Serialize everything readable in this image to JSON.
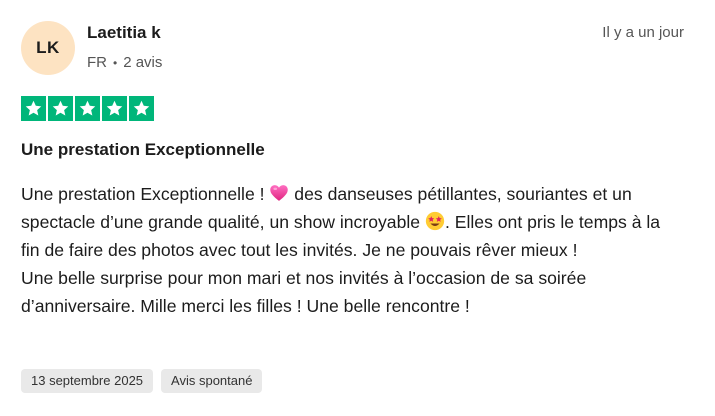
{
  "reviewer": {
    "initials": "LK",
    "name": "Laetitia k",
    "country": "FR",
    "separator": "•",
    "review_count": "2 avis",
    "avatar_color": "#fde3c2"
  },
  "time_ago": "Il y a un jour",
  "rating": {
    "stars": 5,
    "max": 5,
    "color": "#00b67a"
  },
  "review": {
    "title": "Une prestation Exceptionnelle",
    "body_part1": "Une prestation Exceptionnelle ! ",
    "emoji1": "pink-heart",
    "body_part2": " des danseuses pétillantes, souriantes et un spectacle d’une grande qualité, un show incroyable ",
    "emoji2": "star-struck-face",
    "body_part3": ". Elles ont pris le temps à la fin de faire des photos avec tout les invités. Je ne pouvais rêver mieux !",
    "body_part4": "Une belle surprise pour mon mari et nos invités à l’occasion de sa soirée d’anniversaire. Mille merci les filles ! Une belle rencontre !"
  },
  "tags": [
    {
      "label": "13 septembre 2025"
    },
    {
      "label": "Avis spontané"
    }
  ]
}
